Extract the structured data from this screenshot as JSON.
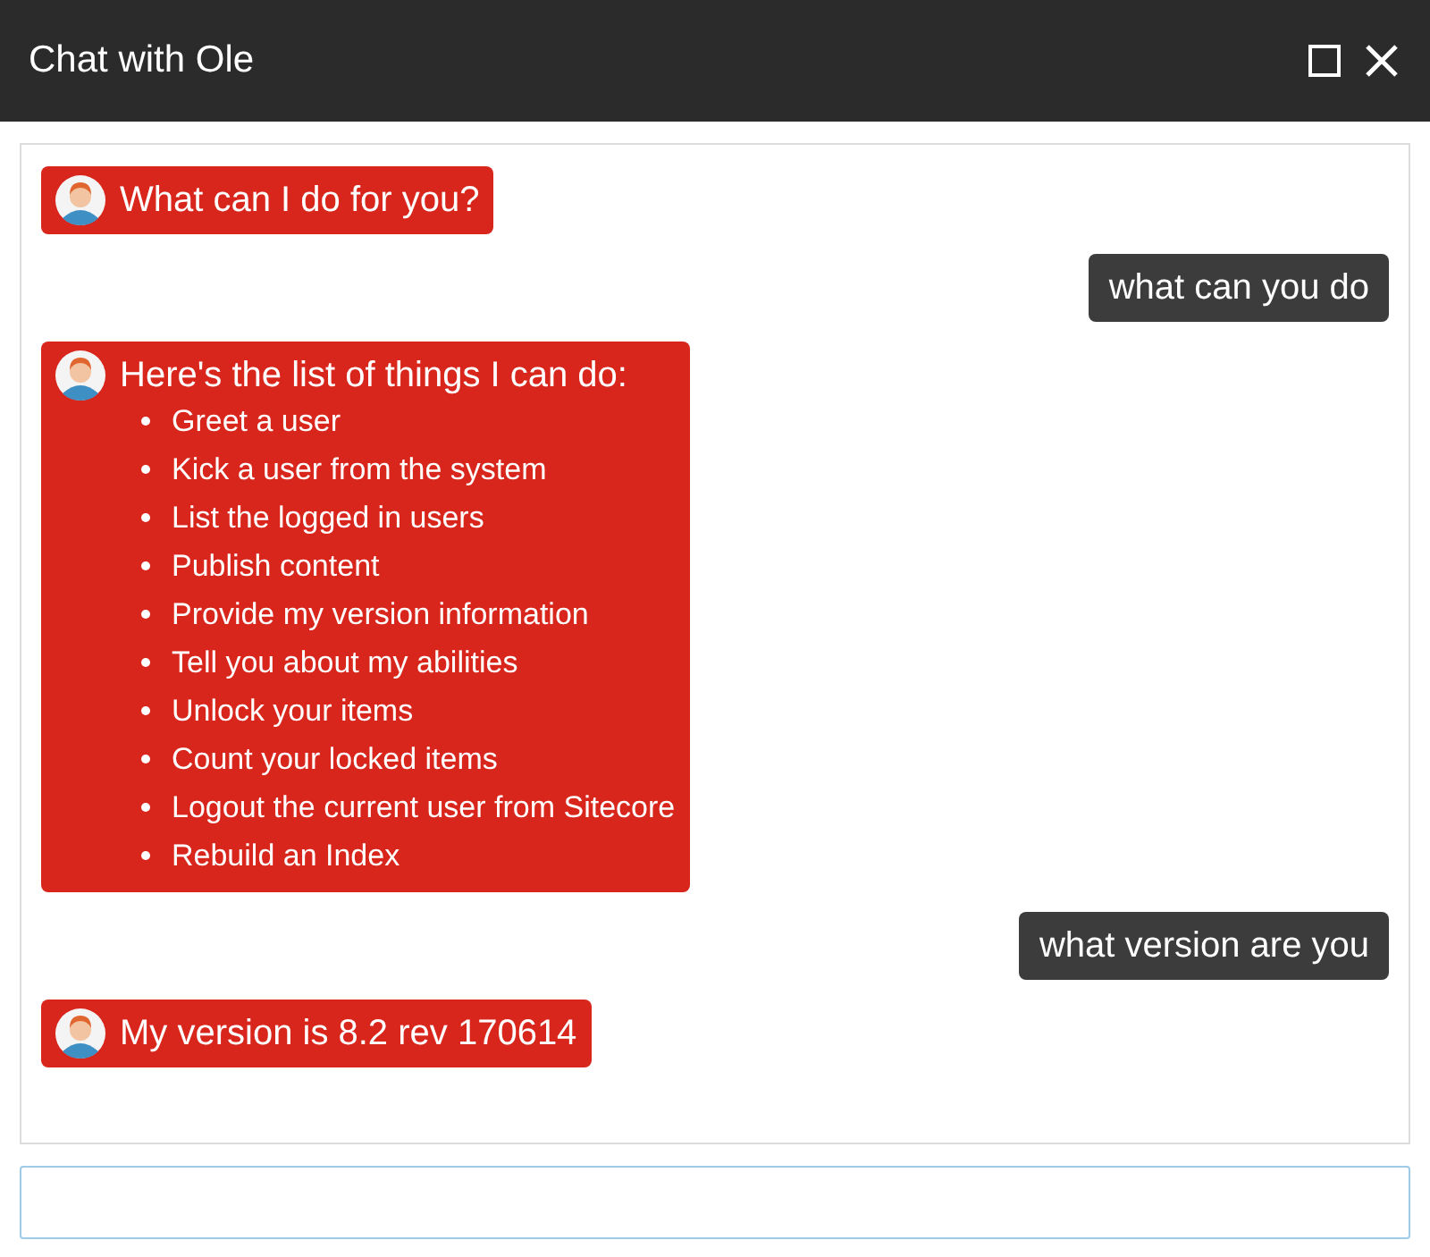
{
  "window": {
    "title": "Chat with Ole"
  },
  "messages": [
    {
      "kind": "bot",
      "text": "What can I do for you?"
    },
    {
      "kind": "user",
      "text": "what can you do"
    },
    {
      "kind": "bot",
      "text": "Here's the list of things I can do:",
      "items": [
        "Greet a user",
        "Kick a user from the system",
        "List the logged in users",
        "Publish content",
        "Provide my version information",
        "Tell you about my abilities",
        "Unlock your items",
        "Count your locked items",
        "Logout the current user from Sitecore",
        "Rebuild an Index"
      ]
    },
    {
      "kind": "user",
      "text": "what version are you"
    },
    {
      "kind": "bot",
      "text": "My version is 8.2 rev 170614"
    }
  ]
}
